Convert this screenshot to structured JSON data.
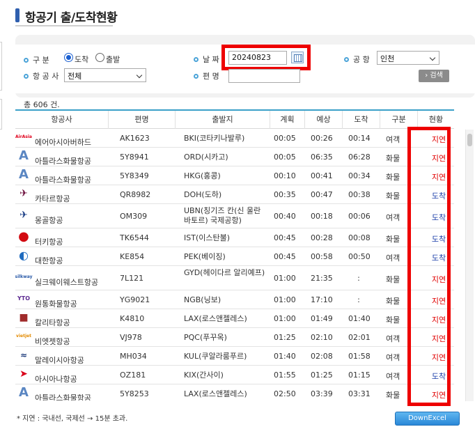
{
  "page": {
    "title": "항공기 출/도착현황"
  },
  "search": {
    "type_label": "구  분",
    "type_options": [
      "도착",
      "출발"
    ],
    "type_selected": "도착",
    "airline_label": "항 공 사",
    "airline_value": "전체",
    "date_label": "날  짜",
    "date_value": "20240823",
    "flight_label": "편  명",
    "flight_value": "",
    "airport_label": "공 항",
    "airport_value": "인천",
    "search_button": "검색"
  },
  "summary": {
    "total_text": "총 606 건."
  },
  "table": {
    "headers": [
      "항공사",
      "편명",
      "출발지",
      "계획",
      "예상",
      "도착",
      "구분",
      "현황"
    ],
    "rows": [
      {
        "logo": "airasia-logo",
        "airline": "에어아시아버하드",
        "flight": "AK1623",
        "origin": "BKI(코타키나발루)",
        "planned": "00:05",
        "expected": "00:26",
        "arrival": "00:14",
        "category": "여객",
        "status": "지연",
        "status_kind": "delay"
      },
      {
        "logo": "atlas-logo",
        "airline": "아틀라스화물항공",
        "flight": "5Y8941",
        "origin": "ORD(시카고)",
        "planned": "00:05",
        "expected": "06:35",
        "arrival": "06:28",
        "category": "화물",
        "status": "지연",
        "status_kind": "delay"
      },
      {
        "logo": "atlas-logo",
        "airline": "아틀라스화물항공",
        "flight": "5Y8349",
        "origin": "HKG(홍콩)",
        "planned": "00:10",
        "expected": "00:41",
        "arrival": "00:34",
        "category": "화물",
        "status": "지연",
        "status_kind": "delay"
      },
      {
        "logo": "qatar-logo",
        "airline": "카타르항공",
        "flight": "QR8982",
        "origin": "DOH(도하)",
        "planned": "00:35",
        "expected": "00:47",
        "arrival": "00:38",
        "category": "화물",
        "status": "도착",
        "status_kind": "arrived"
      },
      {
        "logo": "mongolian-logo",
        "airline": "몽골항공",
        "flight": "OM309",
        "origin": "UBN(칭기즈 칸(신 울란바토르) 국제공항)",
        "planned": "00:40",
        "expected": "00:18",
        "arrival": "00:06",
        "category": "여객",
        "status": "도착",
        "status_kind": "arrived"
      },
      {
        "logo": "turkish-logo",
        "airline": "터키항공",
        "flight": "TK6544",
        "origin": "IST(이스탄불)",
        "planned": "00:45",
        "expected": "00:28",
        "arrival": "00:08",
        "category": "화물",
        "status": "도착",
        "status_kind": "arrived"
      },
      {
        "logo": "koreanair-logo",
        "airline": "대한항공",
        "flight": "KE854",
        "origin": "PEK(베이징)",
        "planned": "00:45",
        "expected": "00:58",
        "arrival": "00:50",
        "category": "여객",
        "status": "도착",
        "status_kind": "arrived"
      },
      {
        "logo": "silkway-logo",
        "airline": "실크웨이웨스트항공",
        "flight": "7L121",
        "origin": "GYD(헤이다르 알리예프)",
        "planned": "01:00",
        "expected": "21:35",
        "arrival": ":",
        "category": "화물",
        "status": "지연",
        "status_kind": "delay"
      },
      {
        "logo": "ytocargo-logo",
        "airline": "원통화물항공",
        "flight": "YG9021",
        "origin": "NGB(닝보)",
        "planned": "01:00",
        "expected": "17:10",
        "arrival": ":",
        "category": "화물",
        "status": "지연",
        "status_kind": "delay"
      },
      {
        "logo": "kalitta-logo",
        "airline": "칼리타항공",
        "flight": "K4810",
        "origin": "LAX(로스앤젤레스)",
        "planned": "01:00",
        "expected": "01:49",
        "arrival": "01:40",
        "category": "화물",
        "status": "지연",
        "status_kind": "delay"
      },
      {
        "logo": "vietjet-logo",
        "airline": "비엣젯항공",
        "flight": "VJ978",
        "origin": "PQC(푸꾸옥)",
        "planned": "01:25",
        "expected": "02:10",
        "arrival": "02:01",
        "category": "여객",
        "status": "지연",
        "status_kind": "delay"
      },
      {
        "logo": "malaysia-logo",
        "airline": "말레이시아항공",
        "flight": "MH034",
        "origin": "KUL(쿠알라룸푸르)",
        "planned": "01:40",
        "expected": "02:08",
        "arrival": "01:58",
        "category": "여객",
        "status": "지연",
        "status_kind": "delay"
      },
      {
        "logo": "asiana-logo",
        "airline": "아시아나항공",
        "flight": "OZ181",
        "origin": "KIX(간사이)",
        "planned": "01:55",
        "expected": "01:25",
        "arrival": "01:15",
        "category": "여객",
        "status": "도착",
        "status_kind": "arrived"
      },
      {
        "logo": "atlas-logo",
        "airline": "아틀라스화물항공",
        "flight": "5Y8253",
        "origin": "LAX(로스앤젤레스)",
        "planned": "02:50",
        "expected": "03:39",
        "arrival": "03:31",
        "category": "화물",
        "status": "지연",
        "status_kind": "delay"
      }
    ]
  },
  "footer": {
    "note": "* 지연 : 국내선, 국제선 → 15분 초과.",
    "excel_button": "DownExcel"
  },
  "colors": {
    "accent": "#2f5fae",
    "delay": "#e00000",
    "arrived": "#1a3da8",
    "highlight_box": "#ee0000",
    "header_line": "#3aa0c8"
  }
}
